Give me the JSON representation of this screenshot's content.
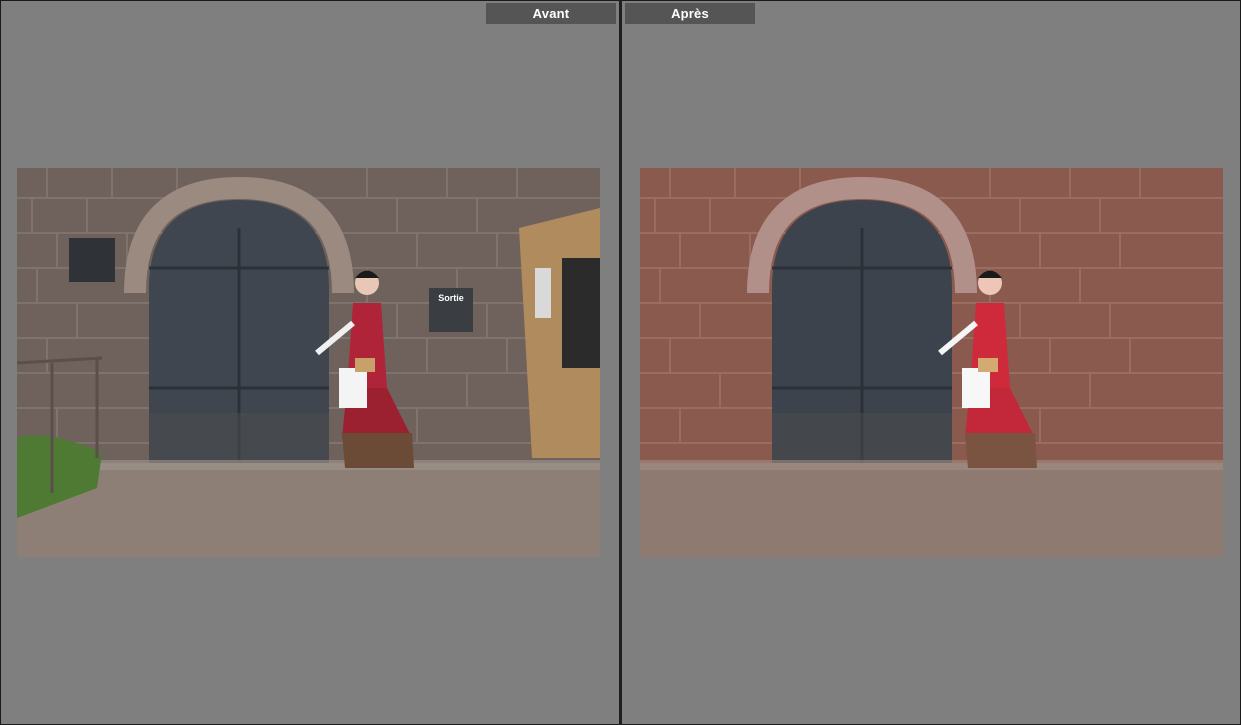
{
  "compare_view": {
    "before_label": "Avant",
    "after_label": "Après"
  },
  "photo": {
    "sign_text": "Sortie",
    "colors": {
      "before_wall": "#6f625c",
      "after_wall": "#8a5a4e",
      "door": "#3f4650",
      "ground": "#8d7f75",
      "dress_red": "#b0243a",
      "skirt_brown": "#6b4a36"
    }
  }
}
